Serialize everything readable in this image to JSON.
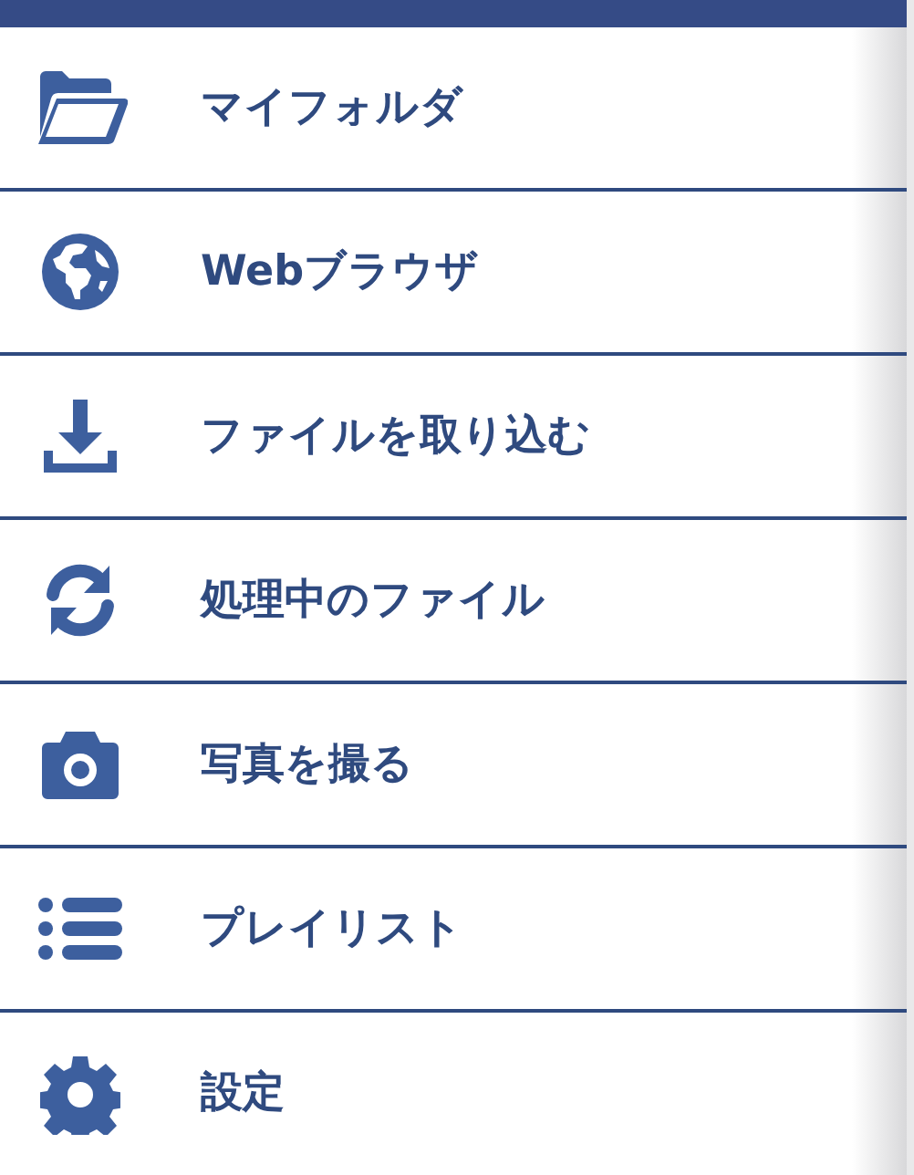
{
  "menu": {
    "items": [
      {
        "kind": "folder",
        "label": "マイフォルダ"
      },
      {
        "kind": "browser",
        "label": "Webブラウザ"
      },
      {
        "kind": "import",
        "label": "ファイルを取り込む"
      },
      {
        "kind": "processing",
        "label": "処理中のファイル"
      },
      {
        "kind": "camera",
        "label": "写真を撮る"
      },
      {
        "kind": "playlist",
        "label": "プレイリスト"
      },
      {
        "kind": "settings",
        "label": "設定"
      }
    ]
  }
}
